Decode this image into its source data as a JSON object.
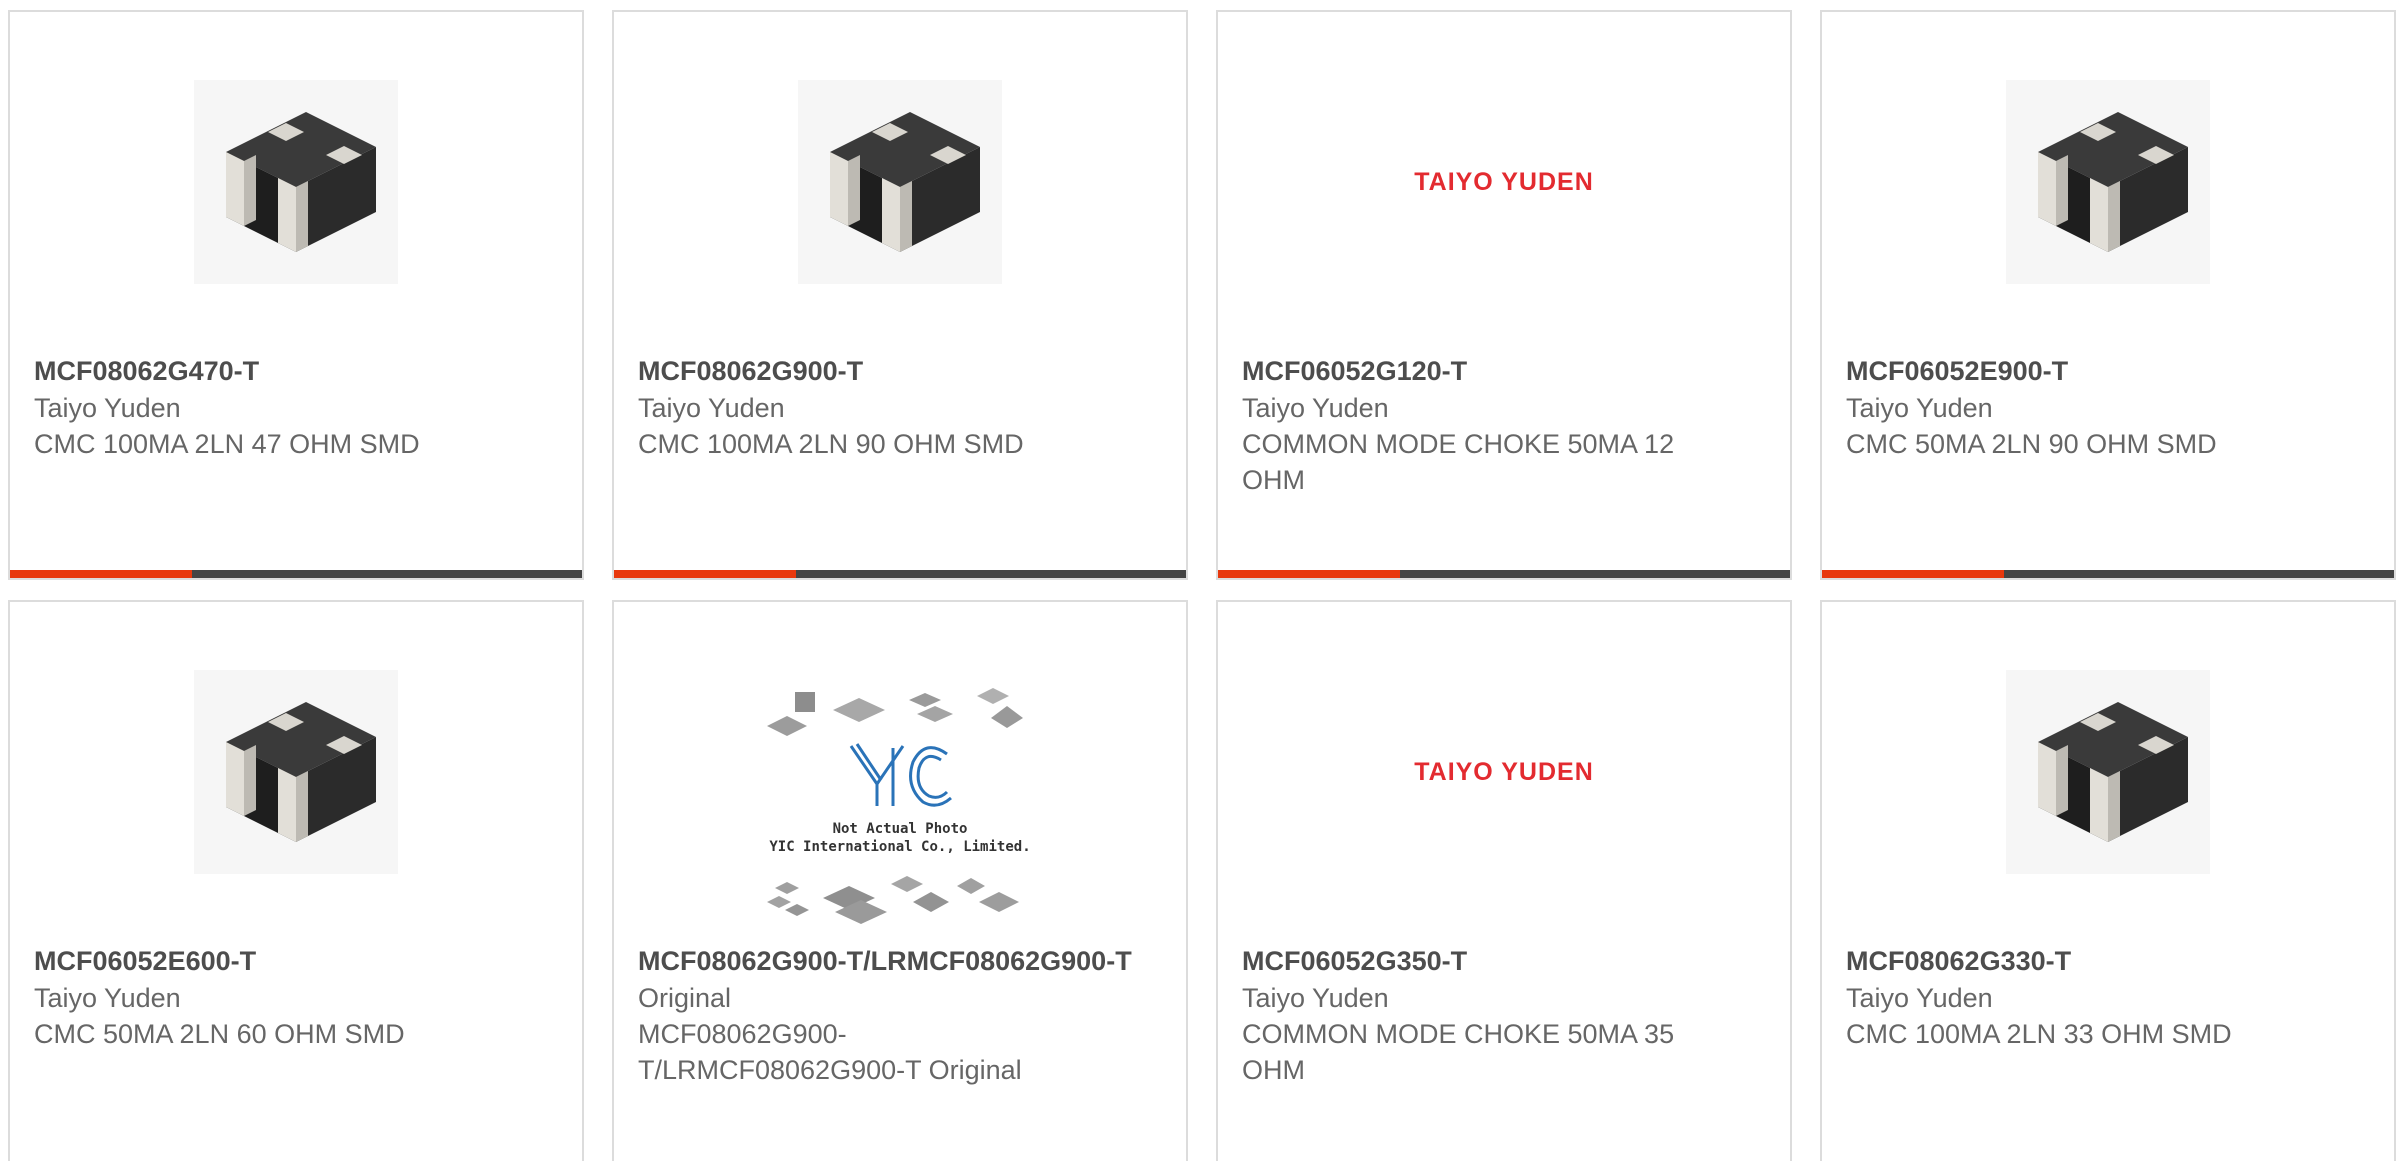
{
  "accent_color": "#e8380d",
  "bar_color": "#444444",
  "products": [
    {
      "part_no": "MCF08062G470-T",
      "manufacturer": "Taiyo Yuden",
      "description": "CMC 100MA 2LN 47 OHM SMD",
      "image": "chip-photo"
    },
    {
      "part_no": "MCF08062G900-T",
      "manufacturer": "Taiyo Yuden",
      "description": "CMC 100MA 2LN 90 OHM SMD",
      "image": "chip-photo"
    },
    {
      "part_no": "MCF06052G120-T",
      "manufacturer": "Taiyo Yuden",
      "description": "COMMON MODE CHOKE 50MA 12 OHM",
      "image": "brand-logo",
      "logo_text": "TAIYO YUDEN"
    },
    {
      "part_no": "MCF06052E900-T",
      "manufacturer": "Taiyo Yuden",
      "description": "CMC 50MA 2LN 90 OHM SMD",
      "image": "chip-photo"
    },
    {
      "part_no": "MCF06052E600-T",
      "manufacturer": "Taiyo Yuden",
      "description": "CMC 50MA 2LN 60 OHM SMD",
      "image": "chip-photo"
    },
    {
      "part_no": "MCF08062G900-T/LRMCF08062G900-T",
      "manufacturer": "Original",
      "description": "MCF08062G900-T/LRMCF08062G900-T Original",
      "image": "placeholder-photo",
      "placeholder_line1": "Not Actual Photo",
      "placeholder_line2": "YIC International Co., Limited."
    },
    {
      "part_no": "MCF06052G350-T",
      "manufacturer": "Taiyo Yuden",
      "description": "COMMON MODE CHOKE 50MA 35 OHM",
      "image": "brand-logo",
      "logo_text": "TAIYO YUDEN"
    },
    {
      "part_no": "MCF08062G330-T",
      "manufacturer": "Taiyo Yuden",
      "description": "CMC 100MA 2LN 33 OHM SMD",
      "image": "chip-photo"
    }
  ]
}
